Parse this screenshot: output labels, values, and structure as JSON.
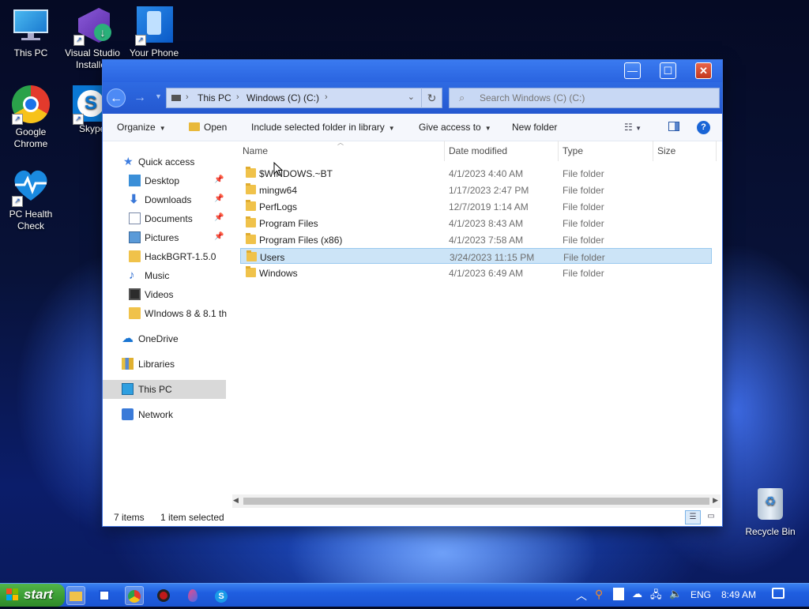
{
  "desktop": {
    "icons": [
      {
        "label": "This PC"
      },
      {
        "label": "Visual Studio Installer"
      },
      {
        "label": "Your Phone"
      },
      {
        "label": "Google Chrome"
      },
      {
        "label": "Skype"
      },
      {
        "label": "PC Health Check"
      },
      {
        "label": "Recycle Bin"
      }
    ]
  },
  "window": {
    "title_buttons": {
      "minimize": "—",
      "maximize": "☐",
      "close": "✕"
    },
    "address": {
      "segments": [
        "This PC",
        "Windows (C) (C:)"
      ]
    },
    "search": {
      "placeholder": "Search Windows (C) (C:)"
    },
    "toolbar": {
      "organize": "Organize",
      "open": "Open",
      "include": "Include selected folder in library",
      "share": "Give access to",
      "new_folder": "New folder"
    },
    "nav": [
      {
        "label": "Quick access"
      },
      {
        "label": "Desktop"
      },
      {
        "label": "Downloads"
      },
      {
        "label": "Documents"
      },
      {
        "label": "Pictures"
      },
      {
        "label": "HackBGRT-1.5.0"
      },
      {
        "label": "Music"
      },
      {
        "label": "Videos"
      },
      {
        "label": "WIndows 8 & 8.1 th"
      },
      {
        "label": "OneDrive"
      },
      {
        "label": "Libraries"
      },
      {
        "label": "This PC"
      },
      {
        "label": "Network"
      }
    ],
    "columns": {
      "name": "Name",
      "date": "Date modified",
      "type": "Type",
      "size": "Size"
    },
    "files": [
      {
        "name": "$WINDOWS.~BT",
        "date": "4/1/2023 4:40 AM",
        "type": "File folder"
      },
      {
        "name": "mingw64",
        "date": "1/17/2023 2:47 PM",
        "type": "File folder"
      },
      {
        "name": "PerfLogs",
        "date": "12/7/2019 1:14 AM",
        "type": "File folder"
      },
      {
        "name": "Program Files",
        "date": "4/1/2023 8:43 AM",
        "type": "File folder"
      },
      {
        "name": "Program Files (x86)",
        "date": "4/1/2023 7:58 AM",
        "type": "File folder"
      },
      {
        "name": "Users",
        "date": "3/24/2023 11:15 PM",
        "type": "File folder"
      },
      {
        "name": "Windows",
        "date": "4/1/2023 6:49 AM",
        "type": "File folder"
      }
    ],
    "status": {
      "count": "7 items",
      "selection": "1 item selected"
    }
  },
  "taskbar": {
    "start_label": "start",
    "tray": {
      "language": "ENG",
      "time": "8:49 AM"
    }
  },
  "colors": {
    "titlebar": "#2a64e0",
    "selection": "#cce4f7",
    "start_green": "#3a9b33",
    "taskbar_blue": "#1f5ee0"
  }
}
